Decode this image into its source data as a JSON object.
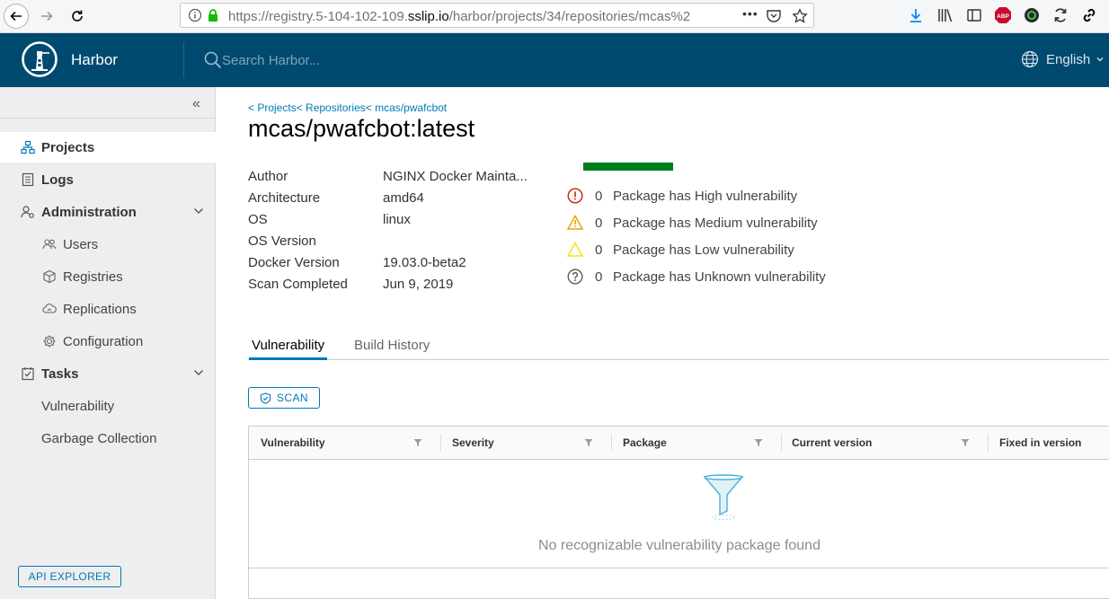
{
  "browser": {
    "url_prefix": "https://registry.5-104-102-109.",
    "url_domain": "sslip.io",
    "url_suffix": "/harbor/projects/34/repositories/mcas%2",
    "more_label": "•••"
  },
  "header": {
    "brand": "Harbor",
    "search_placeholder": "Search Harbor...",
    "language": "English"
  },
  "sidebar": {
    "collapse_glyph": "«",
    "items": [
      {
        "label": "Projects",
        "icon": "projects-icon"
      },
      {
        "label": "Logs",
        "icon": "logs-icon"
      },
      {
        "label": "Administration",
        "icon": "administration-icon"
      },
      {
        "label": "Users",
        "icon": "users-icon"
      },
      {
        "label": "Registries",
        "icon": "registries-icon"
      },
      {
        "label": "Replications",
        "icon": "replications-icon"
      },
      {
        "label": "Configuration",
        "icon": "configuration-icon"
      },
      {
        "label": "Tasks",
        "icon": "tasks-icon"
      },
      {
        "label": "Vulnerability",
        "icon": ""
      },
      {
        "label": "Garbage Collection",
        "icon": ""
      }
    ],
    "api_explorer": "API EXPLORER"
  },
  "breadcrumb": [
    "< Projects",
    "< Repositories",
    "< mcas/pwafcbot"
  ],
  "title": "mcas/pwafcbot:latest",
  "info": [
    {
      "label": "Author",
      "value": "NGINX Docker Mainta..."
    },
    {
      "label": "Architecture",
      "value": "amd64"
    },
    {
      "label": "OS",
      "value": "linux"
    },
    {
      "label": "OS Version",
      "value": ""
    },
    {
      "label": "Docker Version",
      "value": "19.03.0-beta2"
    },
    {
      "label": "Scan Completed",
      "value": "Jun 9, 2019"
    }
  ],
  "vulnerability_summary": {
    "bar_color": "#007e1c",
    "rows": [
      {
        "count": "0",
        "label": "Package has High vulnerability",
        "icon": "high-severity-icon",
        "color": "#c92100"
      },
      {
        "count": "0",
        "label": "Package has Medium vulnerability",
        "icon": "medium-severity-icon",
        "color": "#e8a200"
      },
      {
        "count": "0",
        "label": "Package has Low vulnerability",
        "icon": "low-severity-icon",
        "color": "#f4e400"
      },
      {
        "count": "0",
        "label": "Package has Unknown vulnerability",
        "icon": "unknown-severity-icon",
        "color": "#555555"
      }
    ]
  },
  "tabs": [
    {
      "label": "Vulnerability",
      "active": true
    },
    {
      "label": "Build History",
      "active": false
    }
  ],
  "scan_button": "SCAN",
  "grid": {
    "columns": [
      "Vulnerability",
      "Severity",
      "Package",
      "Current version",
      "Fixed in version"
    ],
    "empty_text": "No recognizable vulnerability package found"
  }
}
